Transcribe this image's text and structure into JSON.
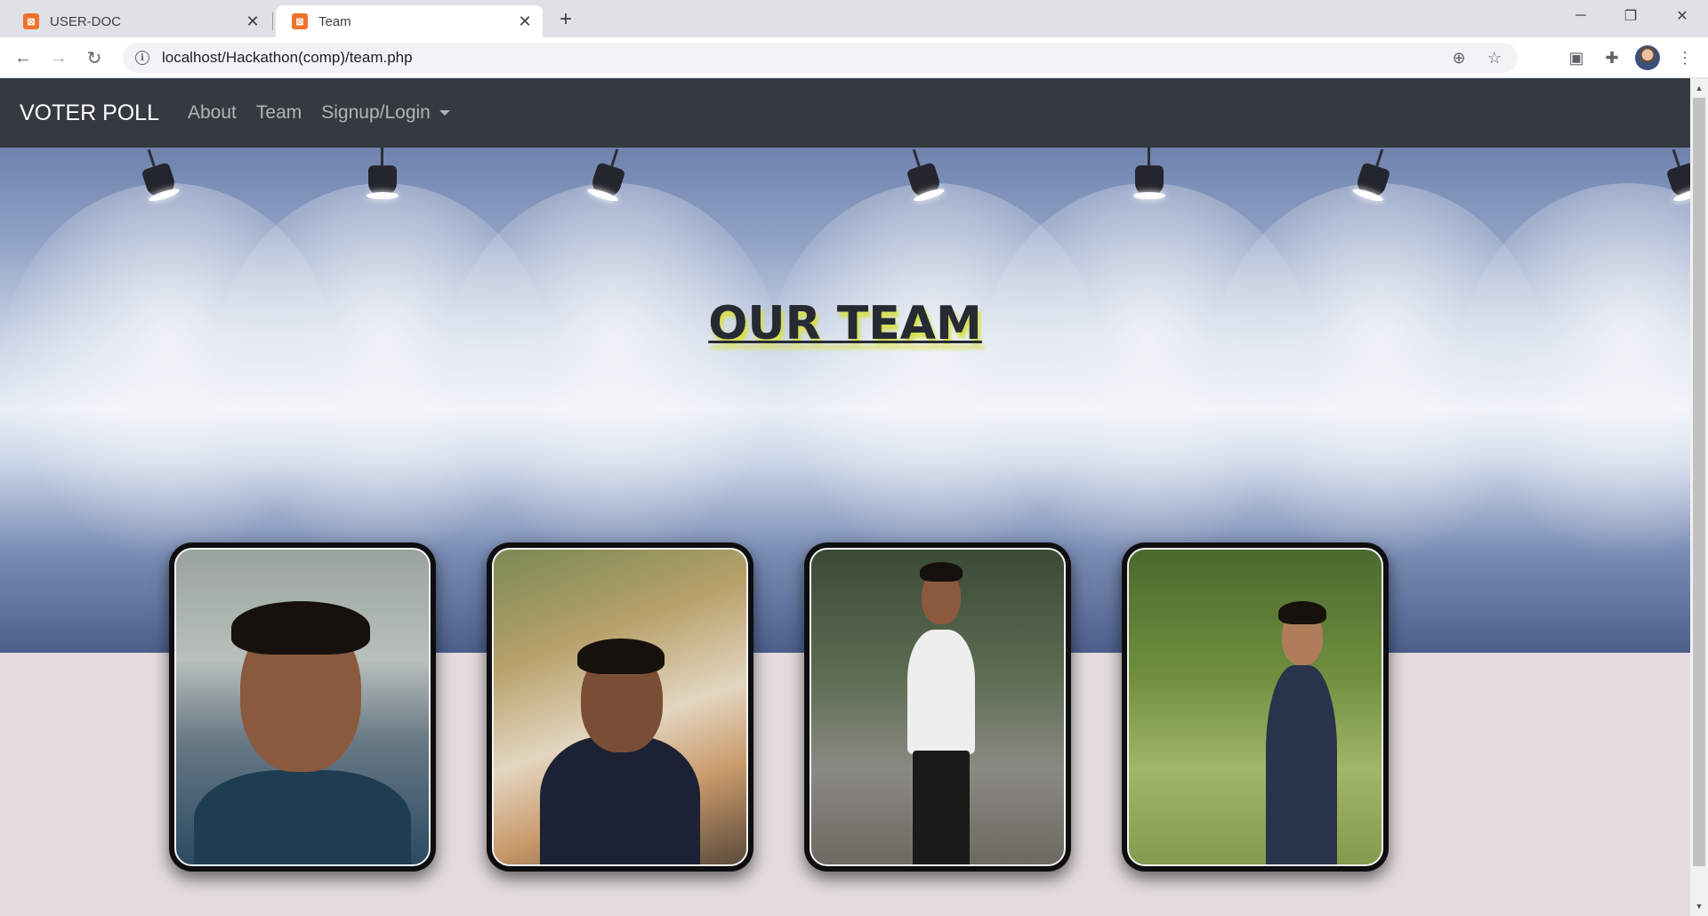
{
  "browser": {
    "tabs": [
      {
        "title": "USER-DOC",
        "favicon": "xampp-icon",
        "active": false
      },
      {
        "title": "Team",
        "favicon": "xampp-icon",
        "active": true
      }
    ],
    "new_tab_icon": "+",
    "url": "localhost/Hackathon(comp)/team.php",
    "window_controls": {
      "minimize": "─",
      "restore": "❐",
      "close": "✕"
    }
  },
  "navbar": {
    "brand": "VOTER POLL",
    "links": [
      {
        "label": "About"
      },
      {
        "label": "Team"
      },
      {
        "label": "Signup/Login",
        "dropdown": true
      }
    ],
    "background": "#343a40"
  },
  "hero": {
    "title": "OUR TEAM",
    "title_shadow_color": "#d8e04a"
  },
  "team": {
    "members": [
      {
        "photo": "team-member-photo-1"
      },
      {
        "photo": "team-member-photo-2"
      },
      {
        "photo": "team-member-photo-3"
      },
      {
        "photo": "team-member-photo-4"
      }
    ]
  },
  "colors": {
    "page_background": "#e3dbdd",
    "card_frame": "#0e0e10"
  }
}
